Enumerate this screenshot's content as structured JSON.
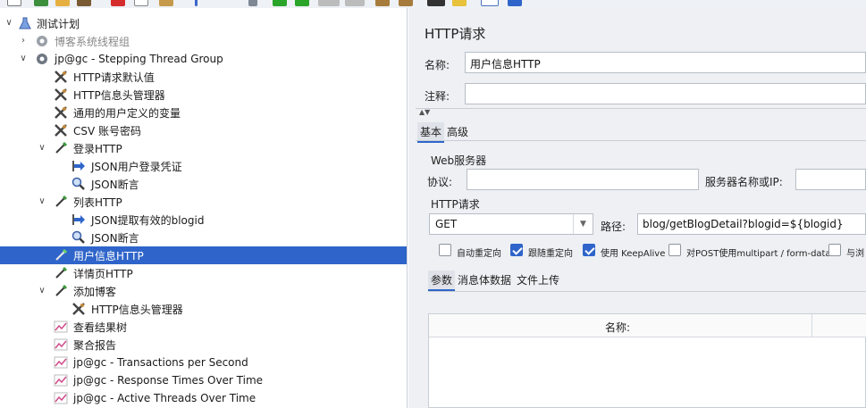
{
  "toolbar": {
    "icons": [
      "new-icon",
      "templates-icon",
      "open-icon",
      "cut-icon",
      "copy-icon",
      "paste-icon",
      "expand-icon",
      "toggle-icon",
      "start-icon",
      "start-no-pause-icon",
      "stop-icon",
      "shutdown-icon",
      "clear-icon",
      "clear-all-icon",
      "search-icon",
      "reset-search-icon",
      "function-helper-icon",
      "help-icon"
    ]
  },
  "tree": {
    "items": [
      {
        "label": "测试计划",
        "icon": "test-plan-icon",
        "expanded": true
      },
      {
        "label": "博客系统线程组",
        "icon": "gear-icon",
        "expanded": false
      },
      {
        "label": "jp@gc - Stepping Thread Group",
        "icon": "gear-icon",
        "expanded": true
      },
      {
        "label": "HTTP请求默认值",
        "icon": "wrench-icon"
      },
      {
        "label": "HTTP信息头管理器",
        "icon": "wrench-icon"
      },
      {
        "label": "通用的用户定义的变量",
        "icon": "wrench-icon"
      },
      {
        "label": "CSV 账号密码",
        "icon": "wrench-icon"
      },
      {
        "label": "登录HTTP",
        "icon": "pipette-icon",
        "expanded": true
      },
      {
        "label": "JSON用户登录凭证",
        "icon": "extractor-icon"
      },
      {
        "label": "JSON断言",
        "icon": "magnifier-icon"
      },
      {
        "label": "列表HTTP",
        "icon": "pipette-icon",
        "expanded": true
      },
      {
        "label": "JSON提取有效的blogid",
        "icon": "extractor-icon"
      },
      {
        "label": "JSON断言",
        "icon": "magnifier-icon"
      },
      {
        "label": "用户信息HTTP",
        "icon": "pipette-icon",
        "selected": true
      },
      {
        "label": "详情页HTTP",
        "icon": "pipette-icon"
      },
      {
        "label": "添加博客",
        "icon": "pipette-icon",
        "expanded": true
      },
      {
        "label": "HTTP信息头管理器",
        "icon": "wrench-icon"
      },
      {
        "label": "查看结果树",
        "icon": "chart-icon"
      },
      {
        "label": "聚合报告",
        "icon": "chart-icon"
      },
      {
        "label": "jp@gc - Transactions per Second",
        "icon": "chart-icon"
      },
      {
        "label": "jp@gc - Response Times Over Time",
        "icon": "chart-icon"
      },
      {
        "label": "jp@gc - Active Threads Over Time",
        "icon": "chart-icon"
      }
    ]
  },
  "panel": {
    "title": "HTTP请求",
    "name_label": "名称:",
    "name_value": "用户信息HTTP",
    "comment_label": "注释:",
    "comment_value": "",
    "tabs": [
      "基本",
      "高级"
    ],
    "web_server_group": "Web服务器",
    "protocol_label": "协议:",
    "protocol_value": "",
    "server_label": "服务器名称或IP:",
    "server_value": "",
    "http_request_group": "HTTP请求",
    "method": "GET",
    "path_label": "路径:",
    "path_value": "blog/getBlogDetail?blogid=${blogid}",
    "checkboxes": [
      {
        "label": "自动重定向",
        "checked": false
      },
      {
        "label": "跟随重定向",
        "checked": true
      },
      {
        "label": "使用 KeepAlive",
        "checked": true
      },
      {
        "label": "对POST使用multipart / form-data",
        "checked": false
      },
      {
        "label": "与浏",
        "checked": false
      }
    ],
    "sub_tabs": [
      "参数",
      "消息体数据",
      "文件上传"
    ],
    "table_header_name": "名称:"
  },
  "colors": {
    "selection": "#2f65ca",
    "panel_bg": "#eef0f3"
  }
}
